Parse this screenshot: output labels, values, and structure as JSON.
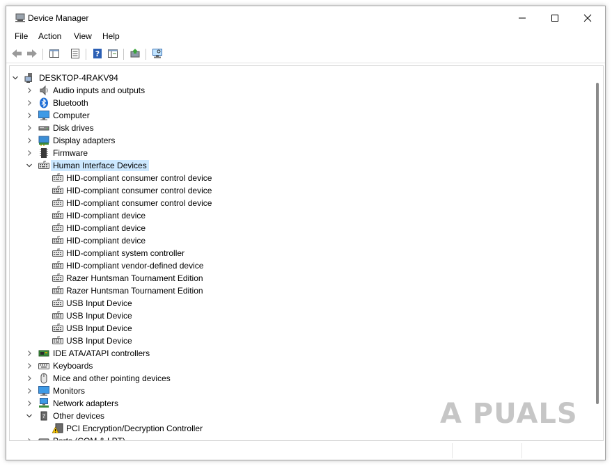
{
  "window": {
    "title": "Device Manager",
    "buttons": [
      "minimize-icon",
      "maximize-icon",
      "close-icon"
    ]
  },
  "menu": [
    "File",
    "Action",
    "View",
    "Help"
  ],
  "toolbar": {
    "buttons": [
      "back-arrow-icon",
      "forward-arrow-icon",
      "show-hide-console-tree-icon",
      "properties-icon",
      "help-icon",
      "run-icon",
      "update-driver-icon",
      "scan-hardware-changes-icon"
    ]
  },
  "tree": {
    "root": "DESKTOP-4RAKV94",
    "rows": [
      {
        "label": "DESKTOP-4RAKV94",
        "level": 0,
        "expander": "expanded",
        "icon": "computer-icon"
      },
      {
        "label": "Audio inputs and outputs",
        "level": 1,
        "expander": "collapsed",
        "icon": "speaker-icon"
      },
      {
        "label": "Bluetooth",
        "level": 1,
        "expander": "collapsed",
        "icon": "bluetooth-icon"
      },
      {
        "label": "Computer",
        "level": 1,
        "expander": "collapsed",
        "icon": "monitor-icon"
      },
      {
        "label": "Disk drives",
        "level": 1,
        "expander": "collapsed",
        "icon": "disk-drive-icon"
      },
      {
        "label": "Display adapters",
        "level": 1,
        "expander": "collapsed",
        "icon": "display-adapter-icon"
      },
      {
        "label": "Firmware",
        "level": 1,
        "expander": "collapsed",
        "icon": "firmware-icon"
      },
      {
        "label": "Human Interface Devices",
        "level": 1,
        "expander": "expanded",
        "icon": "hid-icon",
        "selected": true
      },
      {
        "label": "HID-compliant consumer control device",
        "level": 2,
        "expander": "none",
        "icon": "hid-icon"
      },
      {
        "label": "HID-compliant consumer control device",
        "level": 2,
        "expander": "none",
        "icon": "hid-icon"
      },
      {
        "label": "HID-compliant consumer control device",
        "level": 2,
        "expander": "none",
        "icon": "hid-icon"
      },
      {
        "label": "HID-compliant device",
        "level": 2,
        "expander": "none",
        "icon": "hid-icon"
      },
      {
        "label": "HID-compliant device",
        "level": 2,
        "expander": "none",
        "icon": "hid-icon"
      },
      {
        "label": "HID-compliant device",
        "level": 2,
        "expander": "none",
        "icon": "hid-icon"
      },
      {
        "label": "HID-compliant system controller",
        "level": 2,
        "expander": "none",
        "icon": "hid-icon"
      },
      {
        "label": "HID-compliant vendor-defined device",
        "level": 2,
        "expander": "none",
        "icon": "hid-icon"
      },
      {
        "label": "Razer Huntsman Tournament Edition",
        "level": 2,
        "expander": "none",
        "icon": "hid-icon"
      },
      {
        "label": "Razer Huntsman Tournament Edition",
        "level": 2,
        "expander": "none",
        "icon": "hid-icon"
      },
      {
        "label": "USB Input Device",
        "level": 2,
        "expander": "none",
        "icon": "hid-icon"
      },
      {
        "label": "USB Input Device",
        "level": 2,
        "expander": "none",
        "icon": "hid-icon"
      },
      {
        "label": "USB Input Device",
        "level": 2,
        "expander": "none",
        "icon": "hid-icon"
      },
      {
        "label": "USB Input Device",
        "level": 2,
        "expander": "none",
        "icon": "hid-icon"
      },
      {
        "label": "IDE ATA/ATAPI controllers",
        "level": 1,
        "expander": "collapsed",
        "icon": "ide-controller-icon"
      },
      {
        "label": "Keyboards",
        "level": 1,
        "expander": "collapsed",
        "icon": "keyboard-icon"
      },
      {
        "label": "Mice and other pointing devices",
        "level": 1,
        "expander": "collapsed",
        "icon": "mouse-icon"
      },
      {
        "label": "Monitors",
        "level": 1,
        "expander": "collapsed",
        "icon": "monitor-icon"
      },
      {
        "label": "Network adapters",
        "level": 1,
        "expander": "collapsed",
        "icon": "network-adapter-icon"
      },
      {
        "label": "Other devices",
        "level": 1,
        "expander": "expanded",
        "icon": "other-devices-icon"
      },
      {
        "label": "PCI Encryption/Decryption Controller",
        "level": 2,
        "expander": "none",
        "icon": "warning-device-icon"
      },
      {
        "label": "Ports (COM & LPT)",
        "level": 1,
        "expander": "collapsed",
        "icon": "port-icon"
      }
    ]
  },
  "watermark": "A PUALS",
  "colors": {
    "selection": "#cce8ff",
    "accent_blue": "#2b6cd4",
    "warning_yellow": "#f2c200"
  }
}
